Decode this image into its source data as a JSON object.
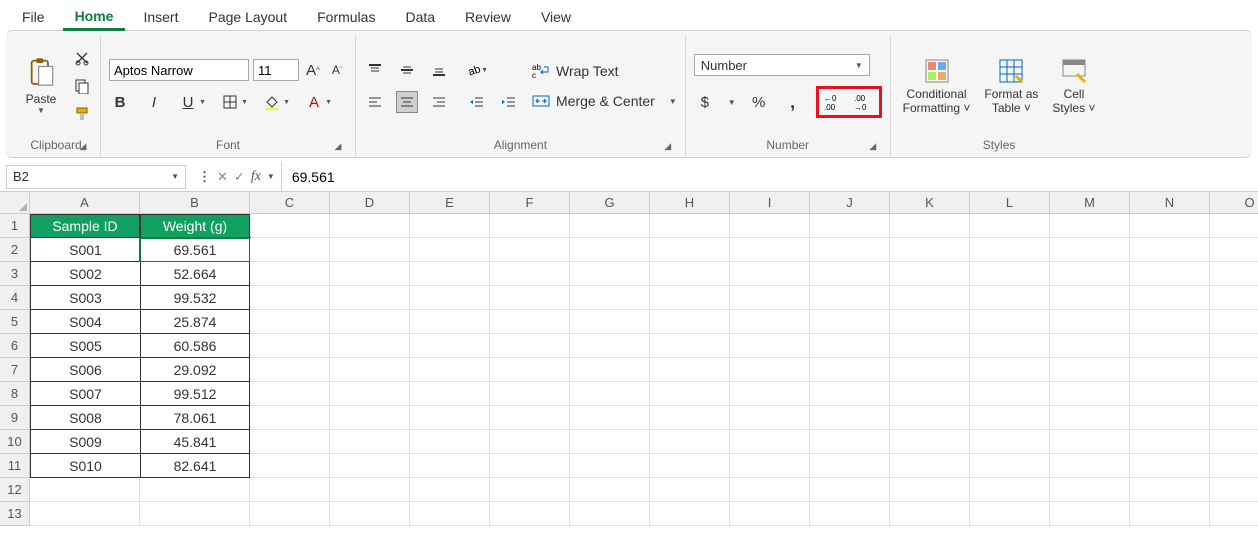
{
  "tabs": [
    "File",
    "Home",
    "Insert",
    "Page Layout",
    "Formulas",
    "Data",
    "Review",
    "View"
  ],
  "active_tab": "Home",
  "clipboard": {
    "paste": "Paste",
    "label": "Clipboard"
  },
  "font": {
    "name": "Aptos Narrow",
    "size": "11",
    "label": "Font"
  },
  "alignment": {
    "wrap": "Wrap Text",
    "merge": "Merge & Center",
    "label": "Alignment"
  },
  "number": {
    "format": "Number",
    "label": "Number",
    "currency": "$",
    "percent": "%",
    "comma": ","
  },
  "styles": {
    "cond": "Conditional\nFormatting",
    "table": "Format as\nTable",
    "cell": "Cell\nStyles",
    "label": "Styles"
  },
  "name_box": "B2",
  "formula_value": "69.561",
  "columns": [
    "A",
    "B",
    "C",
    "D",
    "E",
    "F",
    "G",
    "H",
    "I",
    "J",
    "K",
    "L",
    "M",
    "N",
    "O"
  ],
  "headers": {
    "A": "Sample ID",
    "B": "Weight (g)"
  },
  "rows": [
    {
      "n": 1,
      "A": "Sample ID",
      "B": "Weight (g)",
      "hdr": true
    },
    {
      "n": 2,
      "A": "S001",
      "B": "69.561"
    },
    {
      "n": 3,
      "A": "S002",
      "B": "52.664"
    },
    {
      "n": 4,
      "A": "S003",
      "B": "99.532"
    },
    {
      "n": 5,
      "A": "S004",
      "B": "25.874"
    },
    {
      "n": 6,
      "A": "S005",
      "B": "60.586"
    },
    {
      "n": 7,
      "A": "S006",
      "B": "29.092"
    },
    {
      "n": 8,
      "A": "S007",
      "B": "99.512"
    },
    {
      "n": 9,
      "A": "S008",
      "B": "78.061"
    },
    {
      "n": 10,
      "A": "S009",
      "B": "45.841"
    },
    {
      "n": 11,
      "A": "S010",
      "B": "82.641"
    },
    {
      "n": 12,
      "A": "",
      "B": ""
    },
    {
      "n": 13,
      "A": "",
      "B": ""
    }
  ],
  "selected_cell": "B2"
}
